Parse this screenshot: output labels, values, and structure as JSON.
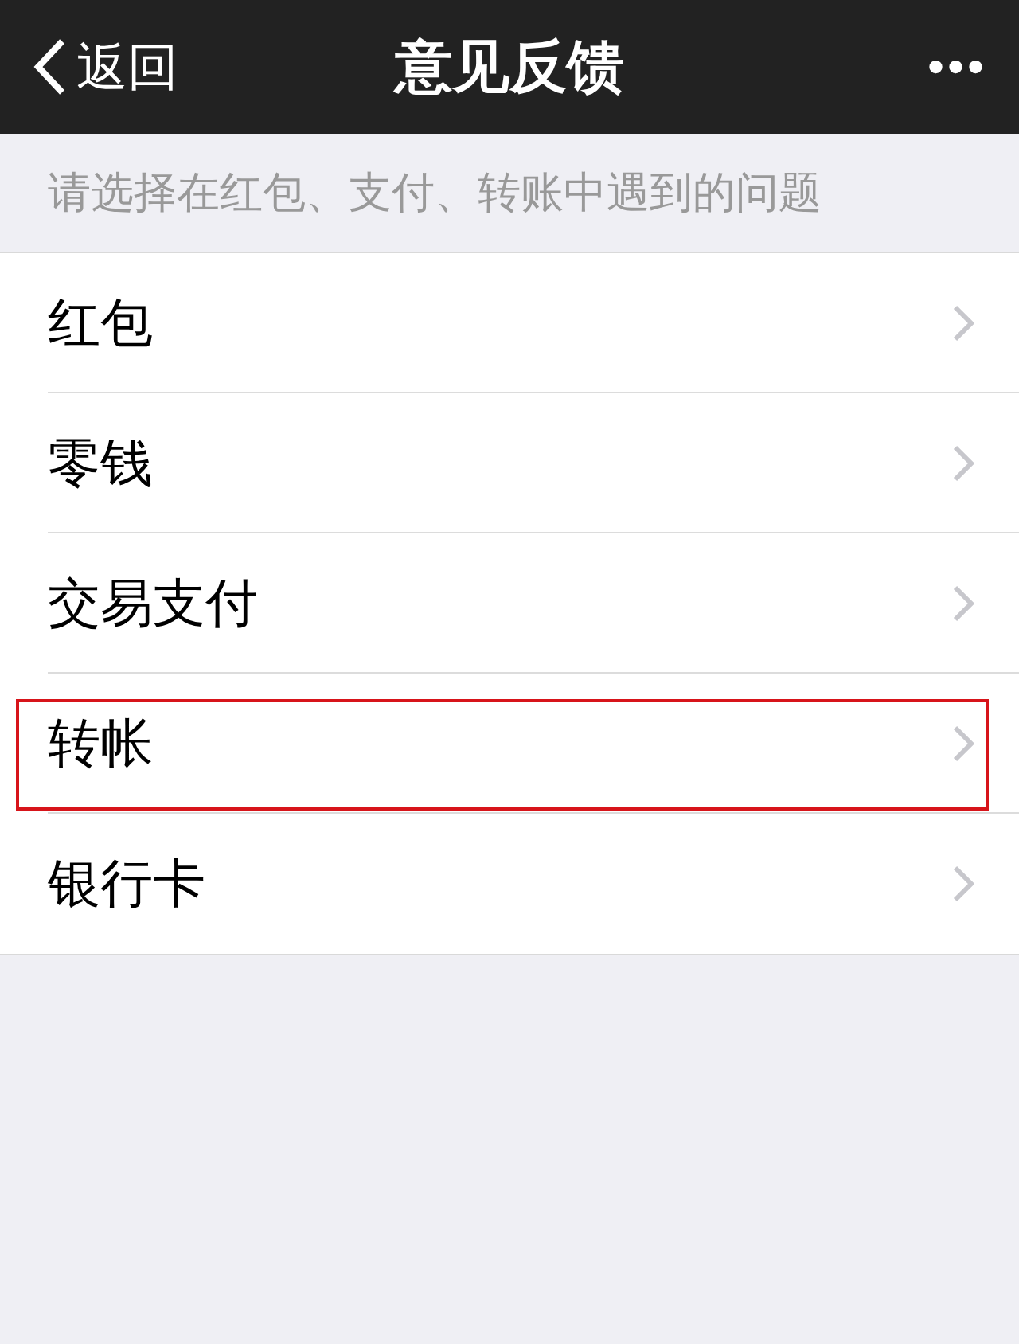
{
  "nav_bar": {
    "back_label": "返回",
    "title": "意见反馈",
    "more": "•••"
  },
  "hint": "请选择在红包、支付、转账中遇到的问题",
  "items": [
    {
      "label": "红包",
      "highlighted": false
    },
    {
      "label": "零钱",
      "highlighted": false
    },
    {
      "label": "交易支付",
      "highlighted": false
    },
    {
      "label": "转帐",
      "highlighted": true
    },
    {
      "label": "银行卡",
      "highlighted": false
    }
  ]
}
